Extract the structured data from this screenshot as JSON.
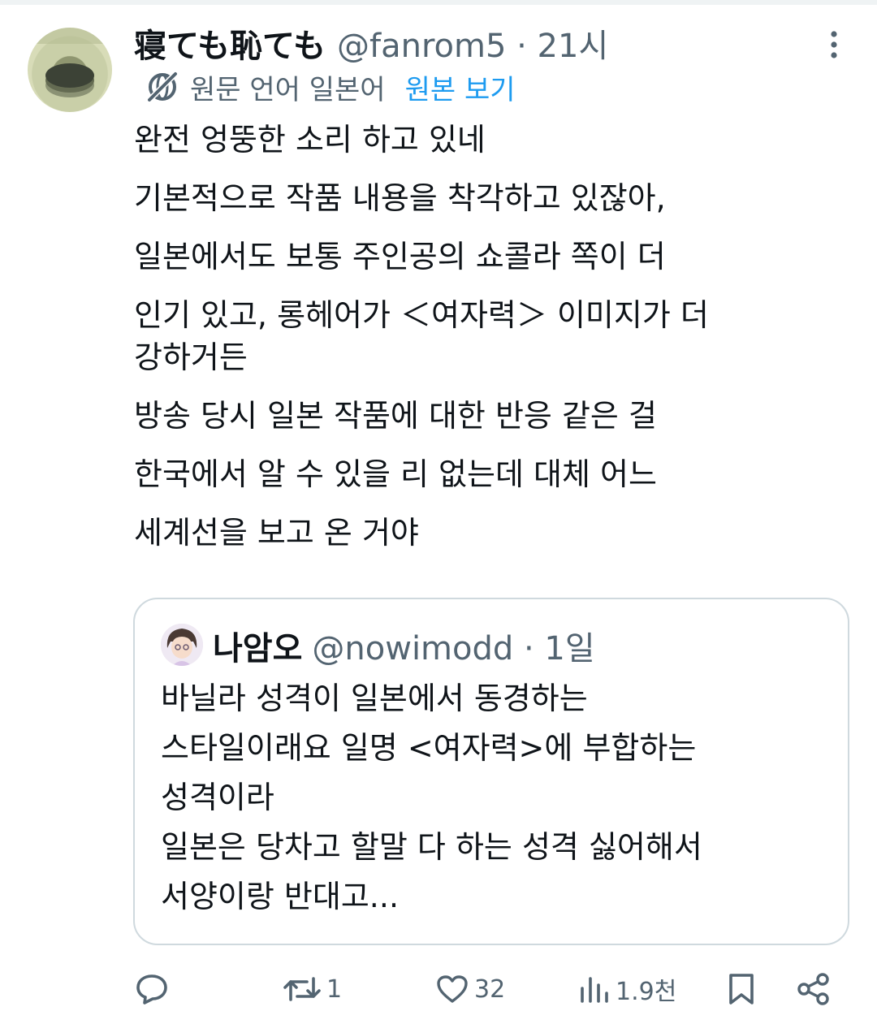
{
  "post": {
    "display_name": "寝ても恥ても",
    "handle_and_time": "@fanrom5 · 21시",
    "translation_note": "원문 언어 일본어",
    "show_original": "원본 보기",
    "text_lines": [
      "완전 엉뚱한 소리 하고 있네",
      "기본적으로 작품 내용을 착각하고 있잖아,",
      "일본에서도 보통 주인공의 쇼콜라 쪽이 더",
      "인기 있고, 롱헤어가 ＜여자력＞ 이미지가 더",
      "강하거든",
      "방송 당시 일본 작품에 대한 반응 같은 걸",
      "한국에서 알 수 있을 리 없는데 대체 어느",
      "세계선을 보고 온 거야"
    ]
  },
  "quoted_post": {
    "display_name": "나암오",
    "handle_and_time": "@nowimodd · 1일",
    "text_lines": [
      "바닐라 성격이 일본에서 동경하는",
      "스타일이래요 일명 <여자력>에 부합하는",
      "성격이라",
      "일본은 당차고 할말 다 하는 성격 싫어해서",
      "서양이랑 반대고..."
    ]
  },
  "actions": {
    "reply": {
      "icon": "reply-icon",
      "count": ""
    },
    "repost": {
      "icon": "repost-icon",
      "count": "1"
    },
    "like": {
      "icon": "heart-icon",
      "count": "32"
    },
    "views": {
      "icon": "views-icon",
      "count": "1.9천"
    },
    "bookmark": {
      "icon": "bookmark-icon"
    },
    "share": {
      "icon": "share-icon"
    }
  },
  "colors": {
    "text": "#0f1419",
    "secondary": "#536471",
    "link": "#1d9bf0",
    "border": "#cfd9de"
  }
}
